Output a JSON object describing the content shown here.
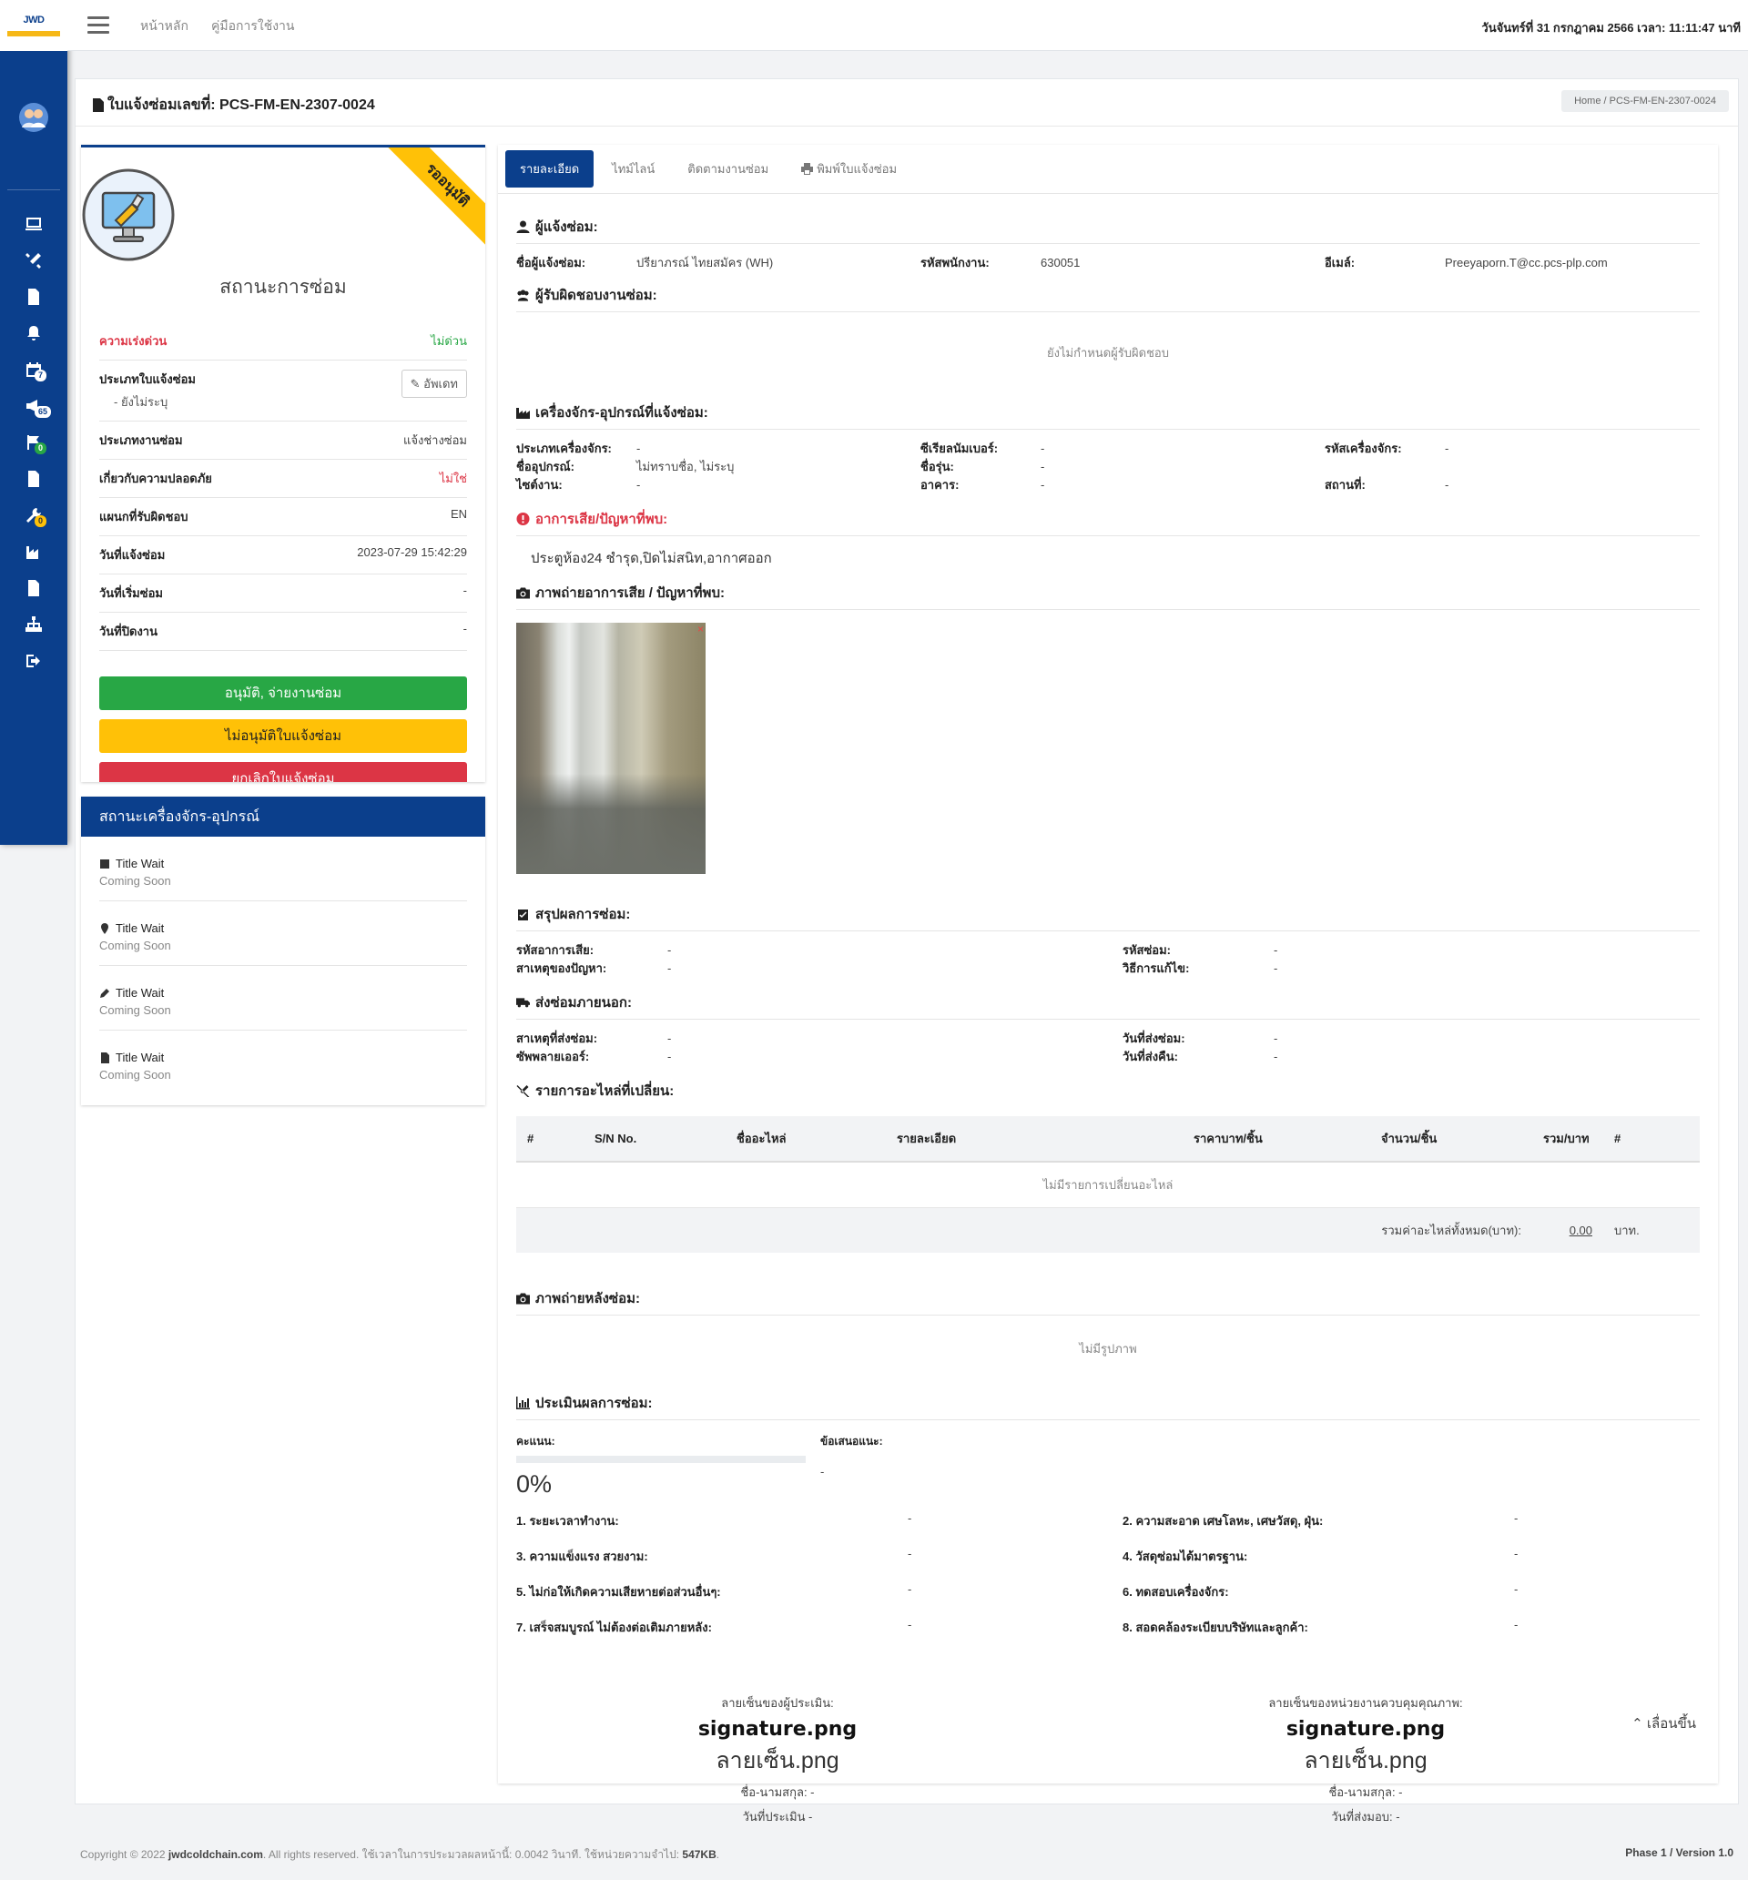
{
  "app": {
    "logo_text": "JWD",
    "brand_color": "#0b3f8c",
    "accent_color": "#ffc107"
  },
  "topbar": {
    "menu_icon": "hamburger-icon",
    "links": [
      "หน้าหลัก",
      "คู่มือการใช้งาน"
    ],
    "datetime": "วันจันทร์ที่ 31 กรกฎาคม 2566 เวลา: 11:11:47 นาที"
  },
  "sidebar": {
    "badges": {
      "calendar": "7",
      "bell": "65",
      "flag": "0",
      "wrench": "0"
    }
  },
  "page": {
    "title": "ใบแจ้งซ่อมเลขที่: PCS-FM-EN-2307-0024",
    "breadcrumb": "Home  /  PCS-FM-EN-2307-0024"
  },
  "status_card": {
    "ribbon": "รออนุมัติ",
    "heading": "สถานะการซ่อม",
    "urgency_label": "ความเร่งด่วน",
    "urgency_value": "ไม่ด่วน",
    "type_label": "ประเภทใบแจ้งซ่อม",
    "type_sub": "- ยังไม่ระบุ",
    "update_label": "อัพเดท",
    "work_type_label": "ประเภทงานซ่อม",
    "work_type_value": "แจ้งช่างซ่อม",
    "safety_label": "เกี่ยวกับความปลอดภัย",
    "safety_value": "ไม่ใช่",
    "dept_label": "แผนกที่รับผิดชอบ",
    "dept_value": "EN",
    "reported_label": "วันที่แจ้งซ่อม",
    "reported_value": "2023-07-29 15:42:29",
    "start_label": "วันที่เริ่มซ่อม",
    "start_value": "-",
    "close_label": "วันที่ปิดงาน",
    "close_value": "-",
    "btn_approve": "อนุมัติ, จ่ายงานซ่อม",
    "btn_reject": "ไม่อนุมัติใบแจ้งซ่อม",
    "btn_cancel": "ยกเลิกใบแจ้งซ่อม"
  },
  "machine_status": {
    "heading": "สถานะเครื่องจักร-อุปกรณ์",
    "items": [
      {
        "icon": "book-icon",
        "title": "Title Wait",
        "sub": "Coming Soon"
      },
      {
        "icon": "map-marker-icon",
        "title": "Title Wait",
        "sub": "Coming Soon"
      },
      {
        "icon": "pencil-icon",
        "title": "Title Wait",
        "sub": "Coming Soon"
      },
      {
        "icon": "file-icon",
        "title": "Title Wait",
        "sub": "Coming Soon"
      }
    ]
  },
  "tabs": [
    "รายละเอียด",
    "ไทม์ไลน์",
    "ติดตามงานซ่อม",
    "พิมพ์ใบแจ้งซ่อม"
  ],
  "reporter": {
    "title": "ผู้แจ้งซ่อม:",
    "name_label": "ชื่อผู้แจ้งซ่อม:",
    "name_value": "ปรียาภรณ์ ไทยสมัคร (WH)",
    "emp_label": "รหัสพนักงาน:",
    "emp_value": "630051",
    "email_label": "อีเมล์:",
    "email_value": "Preeyaporn.T@cc.pcs-plp.com"
  },
  "responsible": {
    "title": "ผู้รับผิดชอบงานซ่อม:",
    "empty": "ยังไม่กำหนดผู้รับผิดชอบ"
  },
  "machine": {
    "title": "เครื่องจักร-อุปกรณ์ที่แจ้งซ่อม:",
    "rows": [
      [
        [
          "ประเภทเครื่องจักร:",
          "-"
        ],
        [
          "ซีเรียลนัมเบอร์:",
          "-"
        ],
        [
          "รหัสเครื่องจักร:",
          "-"
        ]
      ],
      [
        [
          "ชื่ออุปกรณ์:",
          "ไม่ทราบชื่อ, ไม่ระบุ"
        ],
        [
          "ชื่อรุ่น:",
          "-"
        ],
        [
          "",
          ""
        ]
      ],
      [
        [
          "ไซต์งาน:",
          "-"
        ],
        [
          "อาคาร:",
          "-"
        ],
        [
          "สถานที่:",
          "-"
        ]
      ]
    ]
  },
  "problem": {
    "title": "อาการเสีย/ปัญหาที่พบ:",
    "text": "ประตูห้อง24 ชำรุด,ปิดไม่สนิท,อากาศออก"
  },
  "problem_photos": {
    "title": "ภาพถ่ายอาการเสีย / ปัญหาที่พบ:"
  },
  "summary": {
    "title": "สรุปผลการซ่อม:",
    "rows": [
      [
        [
          "รหัสอาการเสีย:",
          "-"
        ],
        [
          "รหัสซ่อม:",
          "-"
        ]
      ],
      [
        [
          "สาเหตุของปัญหา:",
          "-"
        ],
        [
          "วิธีการแก้ไข:",
          "-"
        ]
      ]
    ]
  },
  "outsource": {
    "title": "ส่งซ่อมภายนอก:",
    "rows": [
      [
        [
          "สาเหตุที่ส่งซ่อม:",
          "-"
        ],
        [
          "วันที่ส่งซ่อม:",
          "-"
        ]
      ],
      [
        [
          "ซัพพลายเออร์:",
          "-"
        ],
        [
          "วันที่ส่งคืน:",
          "-"
        ]
      ]
    ]
  },
  "parts": {
    "title": "รายการอะไหล่ที่เปลี่ยน:",
    "headers": [
      "#",
      "S/N No.",
      "ชื่ออะไหล่",
      "รายละเอียด",
      "ราคาบาท/ชิ้น",
      "จำนวน/ชิ้น",
      "รวม/บาท",
      "#"
    ],
    "empty": "ไม่มีรายการเปลี่ยนอะไหล่",
    "total_label": "รวมค่าอะไหล่ทั้งหมด(บาท):",
    "total_value": "0.00",
    "total_unit": "บาท."
  },
  "after_photos": {
    "title": "ภาพถ่ายหลังซ่อม:",
    "empty": "ไม่มีรูปภาพ"
  },
  "evaluation": {
    "title": "ประเมินผลการซ่อม:",
    "score_label": "คะแนน:",
    "score_value": "0%",
    "score_fraction": 0,
    "suggest_label": "ข้อเสนอแนะ:",
    "suggest_value": "-",
    "items": [
      [
        "1. ระยะเวลาทำงาน:",
        "-"
      ],
      [
        "2. ความสะอาด เศษโลหะ, เศษวัสดุ, ฝุ่น:",
        "-"
      ],
      [
        "3. ความแข็งแรง สวยงาม:",
        "-"
      ],
      [
        "4. วัสดุซ่อมได้มาตรฐาน:",
        "-"
      ],
      [
        "5. ไม่ก่อให้เกิดความเสียหายต่อส่วนอื่นๆ:",
        "-"
      ],
      [
        "6. ทดสอบเครื่องจักร:",
        "-"
      ],
      [
        "7. เสร็จสมบูรณ์ ไม่ต้องต่อเติมภายหลัง:",
        "-"
      ],
      [
        "8. สอดคล้องระเบียบบริษัทและลูกค้า:",
        "-"
      ]
    ]
  },
  "signatures": {
    "left": {
      "caption": "ลายเซ็นของผู้ประเมิน:",
      "img": "signature.png",
      "alt": "ลายเซ็น.png",
      "name": "ชื่อ-นามสกุล: -",
      "date": "วันที่ประเมิน -"
    },
    "right": {
      "caption": "ลายเซ็นของหน่วยงานควบคุมคุณภาพ:",
      "img": "signature.png",
      "alt": "ลายเซ็น.png",
      "name": "ชื่อ-นามสกุล: -",
      "date": "วันที่ส่งมอบ: -"
    }
  },
  "scroll_up": "เลื่อนขึ้น",
  "footer": {
    "copyright": "Copyright © 2022 ",
    "site": "jwdcoldchain.com",
    "rest": ". All rights reserved. ใช้เวลาในการประมวลผลหน้านี้: 0.0042 วินาที. ใช้หน่วยความจำไป: ",
    "memory": "547KB",
    "end": ".",
    "version": "Phase 1 / Version 1.0"
  }
}
